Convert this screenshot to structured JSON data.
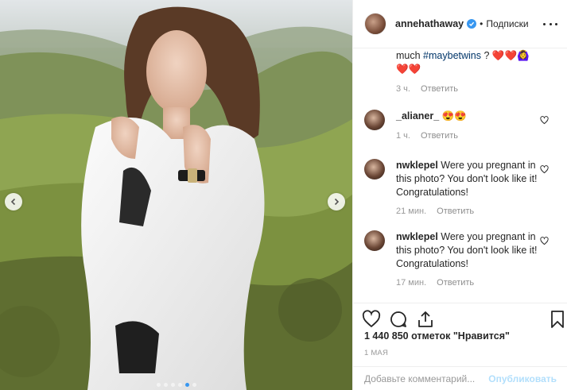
{
  "post": {
    "author": "annehathaway",
    "follow_state": "Подписки",
    "separator": "•",
    "likes_text": "1 440 850 отметок \"Нравится\"",
    "date": "1 МАЯ",
    "carousel": {
      "slides": 6,
      "active_index": 4
    }
  },
  "caption": {
    "line1_prefix": "much ",
    "hashtag": "#maybetwins",
    "line1_suffix": " ? ",
    "emojis_line1": "❤️❤️🙆‍♀️",
    "emojis_line2": "❤️❤️",
    "time": "3 ч.",
    "reply_label": "Ответить"
  },
  "comments": [
    {
      "username": "_alianer_",
      "text": "😍😍",
      "time": "1 ч.",
      "reply_label": "Ответить"
    },
    {
      "username": "nwklepel",
      "text": "Were you pregnant in this photo? You don't look like it! Congratulations!",
      "time": "21 мин.",
      "reply_label": "Ответить"
    },
    {
      "username": "nwklepel",
      "text": "Were you pregnant in this photo? You don't look like it! Congratulations!",
      "time": "17 мин.",
      "reply_label": "Ответить"
    }
  ],
  "composer": {
    "placeholder": "Добавьте комментарий...",
    "publish_label": "Опубликовать"
  },
  "colors": {
    "accent": "#3897f0",
    "publish_disabled": "#b2dffc",
    "hashtag": "#003569",
    "heart": "#ed2b3f"
  }
}
